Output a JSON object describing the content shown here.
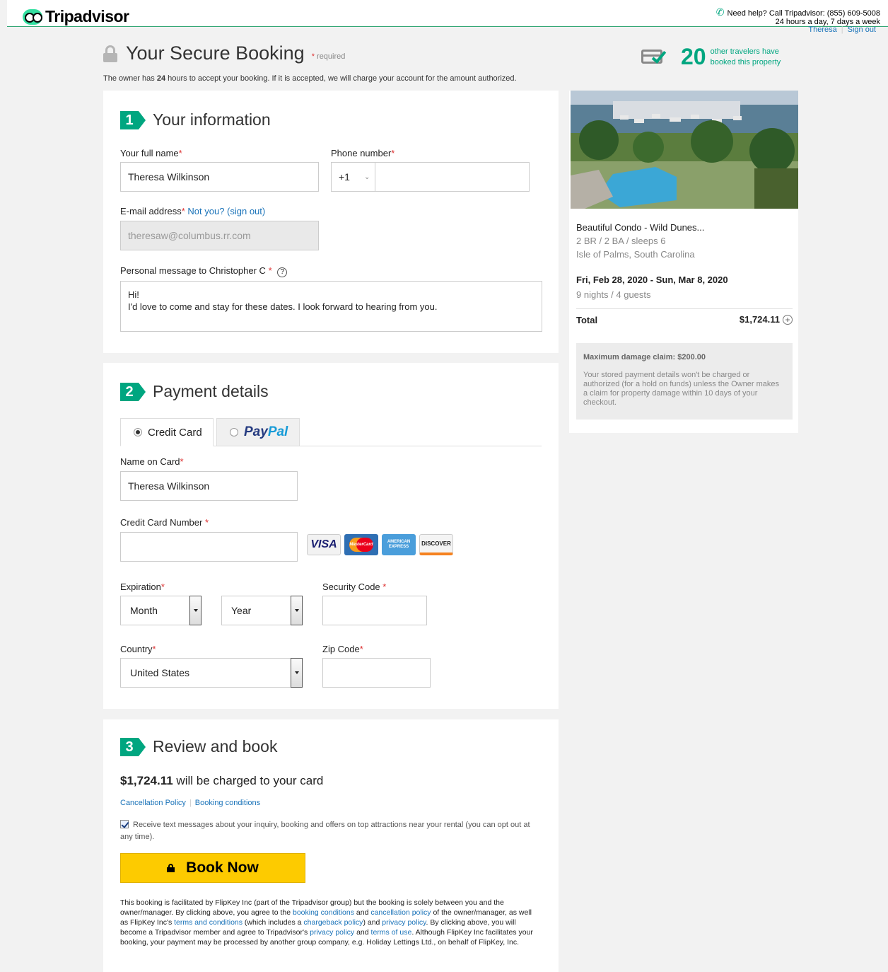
{
  "header": {
    "logo": "Tripadvisor",
    "help_line1": "Need help? Call Tripadvisor: (855) 609-5008",
    "help_line2": "24 hours a day, 7 days a week",
    "user_name": "Theresa",
    "sign_out": "Sign out"
  },
  "page": {
    "title": "Your Secure Booking",
    "required_star": "*",
    "required_note": "required",
    "owner_note_pre": "The owner has ",
    "owner_note_hours": "24",
    "owner_note_post": " hours to accept your booking. If it is accepted, we will charge your account for the amount authorized.",
    "travelers_count": "20",
    "travelers_line1": "other travelers have",
    "travelers_line2": "booked this property"
  },
  "info": {
    "step": "1",
    "heading": "Your information",
    "full_name_label": "Your full name",
    "full_name_value": "Theresa Wilkinson",
    "phone_label": "Phone number",
    "phone_code": "+1",
    "phone_value": "",
    "email_label": "E-mail address",
    "not_you": "Not you? (sign out)",
    "email_value": "theresaw@columbus.rr.com",
    "message_label": "Personal message to Christopher C",
    "message_line1": "Hi!",
    "message_line2": "I'd love to come and stay for these dates. I look forward to hearing from you."
  },
  "payment": {
    "step": "2",
    "heading": "Payment details",
    "tab_credit": "Credit Card",
    "tab_paypal_1": "Pay",
    "tab_paypal_2": "Pal",
    "name_label": "Name on Card",
    "name_value": "Theresa Wilkinson",
    "number_label": "Credit Card Number",
    "number_value": "",
    "cards": [
      "VISA",
      "MasterCard",
      "AMERICAN EXPRESS",
      "DISCOVER"
    ],
    "expiration_label": "Expiration",
    "month_value": "Month",
    "year_value": "Year",
    "security_label": "Security Code",
    "country_label": "Country",
    "country_value": "United States",
    "zip_label": "Zip Code"
  },
  "review": {
    "step": "3",
    "heading": "Review and book",
    "amount": "$1,724.11",
    "charge_text": " will be charged to your card",
    "cancellation_link": "Cancellation Policy",
    "booking_conditions_link": "Booking conditions",
    "sms_text": "Receive text messages about your inquiry, booking and offers on top attractions near your rental (you can opt out at any time).",
    "book_button": "Book Now",
    "fine_1": "This booking is facilitated by FlipKey Inc (part of the Tripadvisor group) but the booking is solely between you and the owner/manager. By clicking above, you agree to the ",
    "fine_link_booking": "booking conditions",
    "fine_2": " and ",
    "fine_link_cancel": "cancellation policy",
    "fine_3": " of the owner/manager, as well as FlipKey Inc's ",
    "fine_link_terms": "terms and conditions",
    "fine_4": " (which includes a ",
    "fine_link_chargeback": "chargeback policy",
    "fine_5": ") and ",
    "fine_link_privacy": "privacy policy",
    "fine_6": ". By clicking above, you will become a Tripadvisor member and agree to Tripadvisor's ",
    "fine_link_ta_privacy": "privacy policy",
    "fine_7": " and ",
    "fine_link_terms_use": "terms of use",
    "fine_8": ". Although FlipKey Inc facilitates your booking, your payment may be processed by another group company, e.g. Holiday Lettings Ltd., on behalf of FlipKey, Inc."
  },
  "sidebar": {
    "property_name": "Beautiful Condo - Wild Dunes...",
    "property_specs": "2 BR / 2 BA / sleeps 6",
    "property_location": "Isle of Palms, South Carolina",
    "dates": "Fri, Feb 28, 2020 - Sun, Mar 8, 2020",
    "nights_guests": "9 nights / 4 guests",
    "total_label": "Total",
    "total_value": "$1,724.11",
    "damage_title": "Maximum damage claim: $200.00",
    "damage_text": "Your stored payment details won't be charged or authorized (for a hold on funds) unless the Owner makes a claim for property damage within 10 days of your checkout."
  },
  "colors": {
    "brand_green": "#00a680",
    "book_yellow": "#fdcb00",
    "link_blue": "#1a73b9"
  }
}
